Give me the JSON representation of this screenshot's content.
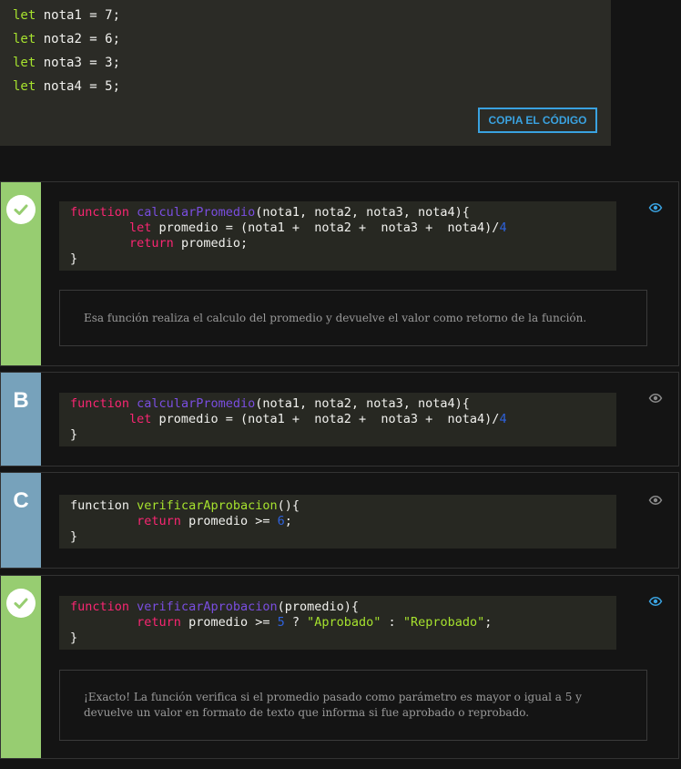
{
  "top_code": {
    "lines": [
      {
        "kw": "let",
        "rest": " nota1 = 7;"
      },
      {
        "kw": "let",
        "rest": " nota2 = 6;"
      },
      {
        "kw": "let",
        "rest": " nota3 = 3;"
      },
      {
        "kw": "let",
        "rest": " nota4 = 5;"
      }
    ],
    "copy_button_label": "COPIA EL CÓDIGO"
  },
  "options": [
    {
      "badge": "check-icon",
      "status": "correct",
      "code": {
        "l1_kw": "function",
        "l1_name": "calcularPromedio",
        "l1_rest": "(nota1, nota2, nota3, nota4){",
        "l2_indent": "        ",
        "l2_kw": "let",
        "l2_rest": " promedio = (nota1 +  nota2 +  nota3 +  nota4)/",
        "l2_num": "4",
        "l3_indent": "        ",
        "l3_kw": "return",
        "l3_rest": " promedio;",
        "l4": "}"
      },
      "feedback": "Esa función realiza el calculo del promedio y devuelve el valor como retorno de la función."
    },
    {
      "badge": "B",
      "code": {
        "l1_kw": "function",
        "l1_name": "calcularPromedio",
        "l1_rest": "(nota1, nota2, nota3, nota4){",
        "l2_indent": "        ",
        "l2_kw": "let",
        "l2_rest": " promedio = (nota1 +  nota2 +  nota3 +  nota4)/",
        "l2_num": "4",
        "l3": "}"
      }
    },
    {
      "badge": "C",
      "code": {
        "l1_kw": "function",
        "l1_name": "verificarAprobacion",
        "l1_rest": "(){",
        "l2_indent": "         ",
        "l2_kw": "return",
        "l2_rest": " promedio >= ",
        "l2_num": "6",
        "l2_end": ";",
        "l3": "}"
      }
    },
    {
      "badge": "check-icon",
      "status": "correct",
      "code": {
        "l1_kw": "function",
        "l1_name": "verificarAprobacion",
        "l1_rest": "(promedio){",
        "l2_indent": "         ",
        "l2_kw": "return",
        "l2_rest": " promedio >= ",
        "l2_num": "5",
        "l2_q": " ? ",
        "l2_str1": "\"Aprobado\"",
        "l2_colon": " : ",
        "l2_str2": "\"Reprobado\"",
        "l2_end": ";",
        "l3": "}"
      },
      "feedback": "¡Exacto! La función verifica si el promedio pasado como parámetro es mayor o igual a 5 y devuelve un valor en formato de texto que informa si fue aprobado o reprobado."
    }
  ],
  "colors": {
    "correct_badge": "#97cd71",
    "option_badge": "#77a2bb",
    "accent": "#3aa2e0"
  }
}
